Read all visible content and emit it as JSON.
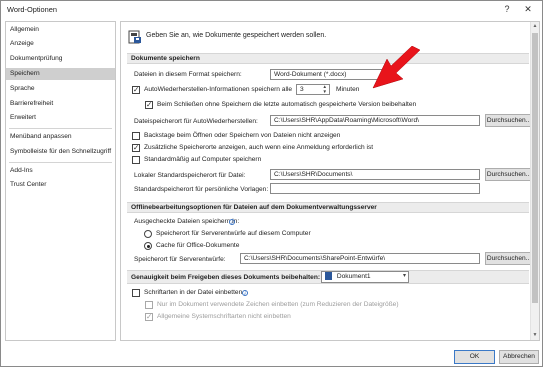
{
  "window": {
    "title": "Word-Optionen",
    "help_label": "?",
    "close_label": "✕"
  },
  "sidebar": {
    "items": [
      {
        "label": "Allgemein"
      },
      {
        "label": "Anzeige"
      },
      {
        "label": "Dokumentprüfung"
      },
      {
        "label": "Speichern",
        "selected": true
      },
      {
        "label": "Sprache"
      },
      {
        "label": "Barrierefreiheit"
      },
      {
        "label": "Erweitert"
      },
      {
        "label": "Menüband anpassen"
      },
      {
        "label": "Symbolleiste für den Schnellzugriff"
      },
      {
        "label": "Add-Ins"
      },
      {
        "label": "Trust Center"
      }
    ]
  },
  "main": {
    "header": "Geben Sie an, wie Dokumente gespeichert werden sollen.",
    "sections": {
      "save_docs": "Dokumente speichern",
      "offline": "Offlinebearbeitungsoptionen für Dateien auf dem Dokumentverwaltungsserver",
      "fidelity": "Genauigkeit beim Freigeben dieses Dokuments beibehalten:"
    },
    "save": {
      "format_label": "Dateien in diesem Format speichern:",
      "format_value": "Word-Dokument (*.docx)",
      "autorecover_label": "AutoWiederherstellen-Informationen speichern alle",
      "autorecover_value": "3",
      "minutes_label": "Minuten",
      "keep_last_label": "Beim Schließen ohne Speichern die letzte automatisch gespeicherte Version beibehalten",
      "autorecover_path_label": "Dateispeicherort für AutoWiederherstellen:",
      "autorecover_path_value": "C:\\Users\\SHR\\AppData\\Roaming\\Microsoft\\Word\\",
      "browse_label": "Durchsuchen...",
      "backstage_label": "Backstage beim Öffnen oder Speichern von Dateien nicht anzeigen",
      "additional_locations_label": "Zusätzliche Speicherorte anzeigen, auch wenn eine Anmeldung erforderlich ist",
      "default_computer_label": "Standardmäßig auf Computer speichern",
      "local_default_label": "Lokaler Standardspeicherort für Datei:",
      "local_default_value": "C:\\Users\\SHR\\Documents\\",
      "personal_templates_label": "Standardspeicherort für persönliche Vorlagen:",
      "personal_templates_value": ""
    },
    "offline": {
      "checked_out_label": "Ausgecheckte Dateien speichern in:",
      "server_drafts_label": "Speicherort für Serverentwürfe auf diesem Computer",
      "office_cache_label": "Cache für Office-Dokumente",
      "server_drafts_path_label": "Speicherort für Serverentwürfe:",
      "server_drafts_path_value": "C:\\Users\\SHR\\Documents\\SharePoint-Entwürfe\\"
    },
    "fidelity": {
      "document_value": "Dokument1",
      "embed_fonts_label": "Schriftarten in der Datei einbetten",
      "only_used_chars_label": "Nur im Dokument verwendete Zeichen einbetten (zum Reduzieren der Dateigröße)",
      "no_system_fonts_label": "Allgemeine Systemschriftarten nicht einbetten"
    }
  },
  "footer": {
    "ok_label": "OK",
    "cancel_label": "Abbrechen"
  },
  "colors": {
    "arrow_red": "#e8141b",
    "selected_nav": "#cfcfcf",
    "section_bg": "#ececec"
  }
}
